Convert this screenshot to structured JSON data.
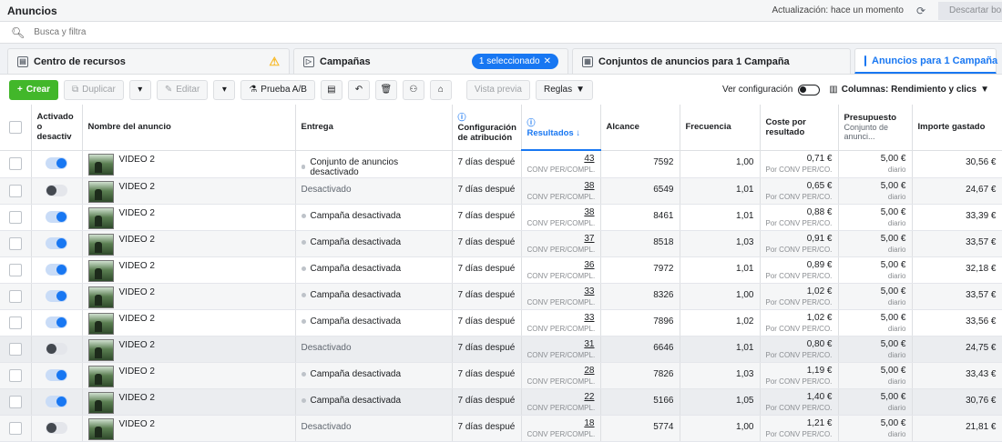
{
  "topbar": {
    "title": "Anuncios",
    "update_text": "Actualización: hace un momento",
    "discard_label": "Descartar borr"
  },
  "search": {
    "placeholder": "Busca y filtra"
  },
  "tabs": {
    "resources": "Centro de recursos",
    "campaigns": "Campañas",
    "selected": "1 seleccionado",
    "adsets": "Conjuntos de anuncios para 1 Campaña",
    "ads": "Anuncios para 1 Campaña"
  },
  "toolbar": {
    "create": "Crear",
    "duplicate": "Duplicar",
    "edit": "Editar",
    "ab_test": "Prueba A/B",
    "preview": "Vista previa",
    "rules": "Reglas",
    "view_config": "Ver configuración",
    "columns": "Columnas: Rendimiento y clics"
  },
  "columns": {
    "status": "Activado o desactiv",
    "name": "Nombre del anuncio",
    "delivery": "Entrega",
    "attribution": "Configuración de atribución",
    "results": "Resultados",
    "reach": "Alcance",
    "frequency": "Frecuencia",
    "cost": "Coste por resultado",
    "budget": "Presupuesto",
    "budget_sub": "Conjunto de anunci...",
    "spent": "Importe gastado"
  },
  "rows": [
    {
      "on": true,
      "name": "VIDEO 2",
      "delivery": "Conjunto de anuncios desactivado",
      "inactive": false,
      "attribution": "7 días despué...",
      "results": "43",
      "results_label": "CONV PER/COMPL...",
      "reach": "7592",
      "frequency": "1,00",
      "cost": "0,71 €",
      "cost_label": "Por CONV PER/CO...",
      "budget": "5,00 €",
      "budget_label": "diario",
      "spent": "30,56 €"
    },
    {
      "on": false,
      "name": "VIDEO 2",
      "delivery": "Desactivado",
      "inactive": true,
      "attribution": "7 días despué...",
      "results": "38",
      "results_label": "CONV PER/COMPL...",
      "reach": "6549",
      "frequency": "1,01",
      "cost": "0,65 €",
      "cost_label": "Por CONV PER/CO...",
      "budget": "5,00 €",
      "budget_label": "diario",
      "spent": "24,67 €"
    },
    {
      "on": true,
      "name": "VIDEO 2",
      "delivery": "Campaña desactivada",
      "inactive": false,
      "attribution": "7 días despué...",
      "results": "38",
      "results_label": "CONV PER/COMPL...",
      "reach": "8461",
      "frequency": "1,01",
      "cost": "0,88 €",
      "cost_label": "Por CONV PER/CO...",
      "budget": "5,00 €",
      "budget_label": "diario",
      "spent": "33,39 €"
    },
    {
      "on": true,
      "name": "VIDEO 2",
      "delivery": "Campaña desactivada",
      "inactive": false,
      "attribution": "7 días despué...",
      "results": "37",
      "results_label": "CONV PER/COMPL...",
      "reach": "8518",
      "frequency": "1,03",
      "cost": "0,91 €",
      "cost_label": "Por CONV PER/CO...",
      "budget": "5,00 €",
      "budget_label": "diario",
      "spent": "33,57 €"
    },
    {
      "on": true,
      "name": "VIDEO 2",
      "delivery": "Campaña desactivada",
      "inactive": false,
      "attribution": "7 días despué...",
      "results": "36",
      "results_label": "CONV PER/COMPL...",
      "reach": "7972",
      "frequency": "1,01",
      "cost": "0,89 €",
      "cost_label": "Por CONV PER/CO...",
      "budget": "5,00 €",
      "budget_label": "diario",
      "spent": "32,18 €"
    },
    {
      "on": true,
      "name": "VIDEO 2",
      "delivery": "Campaña desactivada",
      "inactive": false,
      "attribution": "7 días despué...",
      "results": "33",
      "results_label": "CONV PER/COMPL...",
      "reach": "8326",
      "frequency": "1,00",
      "cost": "1,02 €",
      "cost_label": "Por CONV PER/CO...",
      "budget": "5,00 €",
      "budget_label": "diario",
      "spent": "33,57 €"
    },
    {
      "on": true,
      "name": "VIDEO 2",
      "delivery": "Campaña desactivada",
      "inactive": false,
      "attribution": "7 días despué...",
      "results": "33",
      "results_label": "CONV PER/COMPL...",
      "reach": "7896",
      "frequency": "1,02",
      "cost": "1,02 €",
      "cost_label": "Por CONV PER/CO...",
      "budget": "5,00 €",
      "budget_label": "diario",
      "spent": "33,56 €"
    },
    {
      "on": false,
      "name": "VIDEO 2",
      "delivery": "Desactivado",
      "inactive": true,
      "attribution": "7 días despué...",
      "results": "31",
      "results_label": "CONV PER/COMPL...",
      "reach": "6646",
      "frequency": "1,01",
      "cost": "0,80 €",
      "cost_label": "Por CONV PER/CO...",
      "budget": "5,00 €",
      "budget_label": "diario",
      "spent": "24,75 €"
    },
    {
      "on": true,
      "name": "VIDEO 2",
      "delivery": "Campaña desactivada",
      "inactive": false,
      "attribution": "7 días despué...",
      "results": "28",
      "results_label": "CONV PER/COMPL...",
      "reach": "7826",
      "frequency": "1,03",
      "cost": "1,19 €",
      "cost_label": "Por CONV PER/CO...",
      "budget": "5,00 €",
      "budget_label": "diario",
      "spent": "33,43 €"
    },
    {
      "on": true,
      "name": "VIDEO 2",
      "delivery": "Campaña desactivada",
      "inactive": false,
      "attribution": "7 días despué...",
      "results": "22",
      "results_label": "CONV PER/COMPL...",
      "reach": "5166",
      "frequency": "1,05",
      "cost": "1,40 €",
      "cost_label": "Por CONV PER/CO...",
      "budget": "5,00 €",
      "budget_label": "diario",
      "spent": "30,76 €"
    },
    {
      "on": false,
      "name": "VIDEO 2",
      "delivery": "Desactivado",
      "inactive": true,
      "attribution": "7 días despué...",
      "results": "18",
      "results_label": "CONV PER/COMPL...",
      "reach": "5774",
      "frequency": "1,00",
      "cost": "1,21 €",
      "cost_label": "Por CONV PER/CO...",
      "budget": "5,00 €",
      "budget_label": "diario",
      "spent": "21,81 €"
    }
  ]
}
